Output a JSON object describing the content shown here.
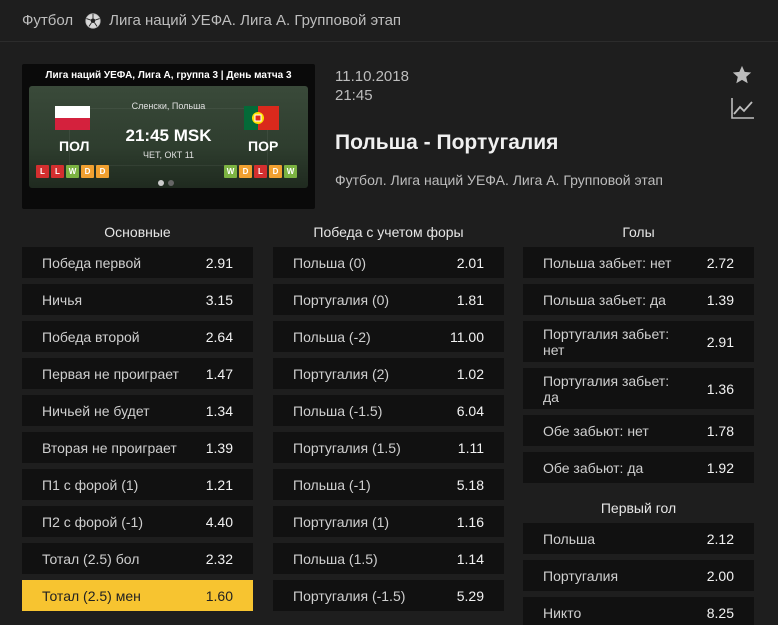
{
  "breadcrumb": {
    "sport": "Футбол",
    "competition": "Лига наций УЕФА. Лига А. Групповой этап"
  },
  "banner": {
    "title": "Лига наций УЕФА, Лига  А, группа 3 | День матча 3",
    "venue": "Сленски, Польша",
    "kickoff": "21:45 MSK",
    "date": "ЧЕТ, ОКТ 11",
    "home_abbr": "ПОЛ",
    "away_abbr": "ПОР",
    "home_form": [
      "L",
      "L",
      "W",
      "D",
      "D"
    ],
    "away_form": [
      "W",
      "D",
      "L",
      "D",
      "W"
    ]
  },
  "match": {
    "date": "11.10.2018",
    "time": "21:45",
    "title": "Польша - Португалия",
    "subtitle": "Футбол. Лига наций УЕФА. Лига А. Групповой этап"
  },
  "markets": {
    "main": {
      "title": "Основные",
      "rows": [
        {
          "label": "Победа первой",
          "odds": "2.91"
        },
        {
          "label": "Ничья",
          "odds": "3.15"
        },
        {
          "label": "Победа второй",
          "odds": "2.64"
        },
        {
          "label": "Первая не проиграет",
          "odds": "1.47"
        },
        {
          "label": "Ничьей не будет",
          "odds": "1.34"
        },
        {
          "label": "Вторая не проиграет",
          "odds": "1.39"
        },
        {
          "label": "П1 с форой (1)",
          "odds": "1.21"
        },
        {
          "label": "П2 с форой (-1)",
          "odds": "4.40"
        },
        {
          "label": "Тотал (2.5) бол",
          "odds": "2.32"
        },
        {
          "label": "Тотал (2.5) мен",
          "odds": "1.60"
        }
      ]
    },
    "handicap": {
      "title": "Победа с учетом форы",
      "rows": [
        {
          "label": "Польша (0)",
          "odds": "2.01"
        },
        {
          "label": "Португалия (0)",
          "odds": "1.81"
        },
        {
          "label": "Польша (-2)",
          "odds": "11.00"
        },
        {
          "label": "Португалия (2)",
          "odds": "1.02"
        },
        {
          "label": "Польша (-1.5)",
          "odds": "6.04"
        },
        {
          "label": "Португалия (1.5)",
          "odds": "1.11"
        },
        {
          "label": "Польша (-1)",
          "odds": "5.18"
        },
        {
          "label": "Португалия (1)",
          "odds": "1.16"
        },
        {
          "label": "Польша (1.5)",
          "odds": "1.14"
        },
        {
          "label": "Португалия (-1.5)",
          "odds": "5.29"
        }
      ]
    },
    "goals": {
      "title": "Голы",
      "rows": [
        {
          "label": "Польша забьет: нет",
          "odds": "2.72"
        },
        {
          "label": "Польша забьет: да",
          "odds": "1.39"
        },
        {
          "label": "Португалия забьет: нет",
          "odds": "2.91"
        },
        {
          "label": "Португалия забьет: да",
          "odds": "1.36"
        },
        {
          "label": "Обе забьют: нет",
          "odds": "1.78"
        },
        {
          "label": "Обе забьют: да",
          "odds": "1.92"
        }
      ]
    },
    "first_goal": {
      "title": "Первый гол",
      "rows": [
        {
          "label": "Польша",
          "odds": "2.12"
        },
        {
          "label": "Португалия",
          "odds": "2.00"
        },
        {
          "label": "Никто",
          "odds": "8.25"
        }
      ]
    }
  },
  "colors": {
    "selected": "#f7c430",
    "row_bg": "#111111",
    "page_bg": "#1e1e1e"
  },
  "icons": {
    "sport": "soccer-ball-icon",
    "favorite": "star-icon",
    "stats": "line-chart-icon"
  }
}
